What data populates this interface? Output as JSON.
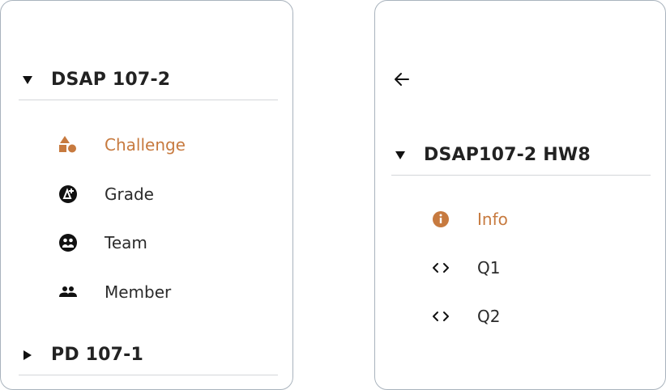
{
  "colors": {
    "accent": "#c77a3f",
    "text": "#2b2b2b",
    "divider": "#d3d6d9",
    "border": "#a9b3bd"
  },
  "left_panel": {
    "groups": [
      {
        "title": "DSAP 107-2",
        "expanded": true,
        "items": [
          {
            "label": "Challenge",
            "icon": "shapes-icon",
            "active": true
          },
          {
            "label": "Grade",
            "icon": "grade-icon",
            "active": false
          },
          {
            "label": "Team",
            "icon": "team-icon",
            "active": false
          },
          {
            "label": "Member",
            "icon": "people-icon",
            "active": false
          }
        ]
      },
      {
        "title": "PD 107-1",
        "expanded": false
      }
    ]
  },
  "right_panel": {
    "back_icon": "arrow-left-icon",
    "group": {
      "title": "DSAP107-2 HW8",
      "expanded": true,
      "items": [
        {
          "label": "Info",
          "icon": "info-icon",
          "active": true
        },
        {
          "label": "Q1",
          "icon": "code-icon",
          "active": false
        },
        {
          "label": "Q2",
          "icon": "code-icon",
          "active": false
        }
      ]
    }
  }
}
